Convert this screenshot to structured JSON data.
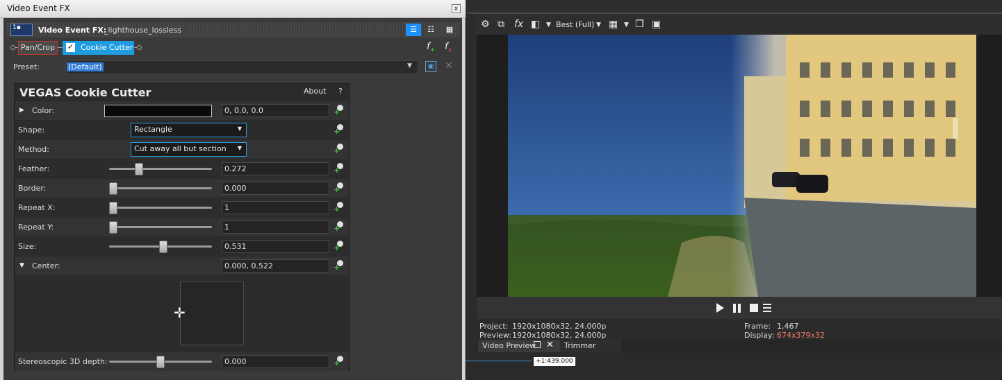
{
  "fx_window": {
    "title": "Video Event FX",
    "close": "x",
    "header_label": "Video Event FX:",
    "header_name": "_lighthouse_lossless",
    "chain": [
      "Pan/Crop",
      "Cookie Cutter"
    ],
    "preset_label": "Preset:",
    "preset_value": "(Default)"
  },
  "plugin": {
    "title": "VEGAS Cookie Cutter",
    "about": "About",
    "help": "?",
    "params": {
      "color": {
        "label": "Color:",
        "value": "0, 0.0, 0.0"
      },
      "shape": {
        "label": "Shape:",
        "value": "Rectangle"
      },
      "method": {
        "label": "Method:",
        "value": "Cut away all but section"
      },
      "feather": {
        "label": "Feather:",
        "value": "0.272",
        "level": 0.272
      },
      "border": {
        "label": "Border:",
        "value": "0.000",
        "level": 0.0
      },
      "repeat_x": {
        "label": "Repeat X:",
        "value": "1",
        "level": 0.0
      },
      "repeat_y": {
        "label": "Repeat Y:",
        "value": "1",
        "level": 0.0
      },
      "size": {
        "label": "Size:",
        "value": "0.531",
        "level": 0.531
      },
      "center": {
        "label": "Center:",
        "value": "0.000, 0.522"
      },
      "stereo": {
        "label": "Stereoscopic 3D depth:",
        "value": "0.000",
        "level": 0.5
      }
    }
  },
  "preview": {
    "quality": "Best (Full)",
    "project_label": "Project:",
    "project_value": "1920x1080x32, 24.000p",
    "preview_label": "Preview:",
    "preview_value": "1920x1080x32, 24.000p",
    "frame_label": "Frame:",
    "frame_value": "1,467",
    "display_label": "Display:",
    "display_value": "674x379x32",
    "tabs": [
      "Video Preview",
      "Trimmer"
    ],
    "timecode": "+1:439.000"
  },
  "colors": {
    "accent": "#1f9ce0",
    "display_value": "#f07a6a",
    "keyframe_plus": "#3cc33c"
  }
}
